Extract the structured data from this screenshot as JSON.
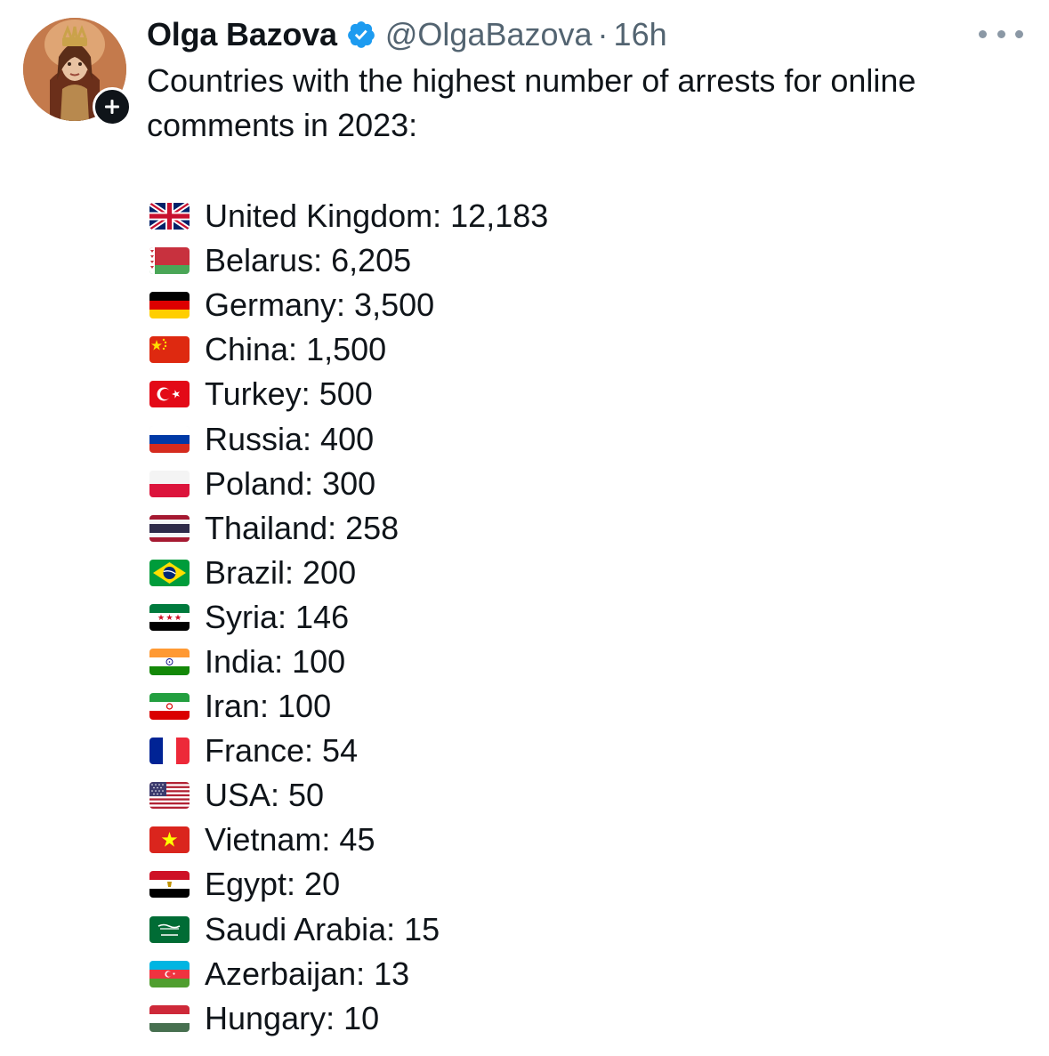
{
  "author": {
    "name": "Olga Bazova",
    "handle": "@OlgaBazova",
    "separator": "·",
    "time": "16h",
    "verified": true
  },
  "icons": {
    "verified": "verified-badge-icon",
    "follow": "plus-icon",
    "more": "more-horizontal-icon"
  },
  "colors": {
    "text": "#0f1419",
    "muted": "#536471",
    "verified": "#1d9bf0"
  },
  "tweet": {
    "intro": "Countries with the highest number of arrests for online comments in 2023:",
    "items": [
      {
        "flag": "uk",
        "text": "United Kingdom: 12,183"
      },
      {
        "flag": "belarus",
        "text": "Belarus: 6,205"
      },
      {
        "flag": "germany",
        "text": "Germany: 3,500"
      },
      {
        "flag": "china",
        "text": "China: 1,500"
      },
      {
        "flag": "turkey",
        "text": "Turkey: 500"
      },
      {
        "flag": "russia",
        "text": "Russia: 400"
      },
      {
        "flag": "poland",
        "text": "Poland: 300"
      },
      {
        "flag": "thailand",
        "text": "Thailand: 258"
      },
      {
        "flag": "brazil",
        "text": "Brazil: 200"
      },
      {
        "flag": "syria",
        "text": "Syria: 146"
      },
      {
        "flag": "india",
        "text": "India: 100"
      },
      {
        "flag": "iran",
        "text": "Iran: 100"
      },
      {
        "flag": "france",
        "text": "France: 54"
      },
      {
        "flag": "usa",
        "text": "USA: 50"
      },
      {
        "flag": "vietnam",
        "text": "Vietnam: 45"
      },
      {
        "flag": "egypt",
        "text": "Egypt: 20"
      },
      {
        "flag": "saudi-arabia",
        "text": "Saudi Arabia: 15"
      },
      {
        "flag": "azerbaijan",
        "text": "Azerbaijan: 13"
      },
      {
        "flag": "hungary",
        "text": "Hungary: 10"
      }
    ]
  }
}
